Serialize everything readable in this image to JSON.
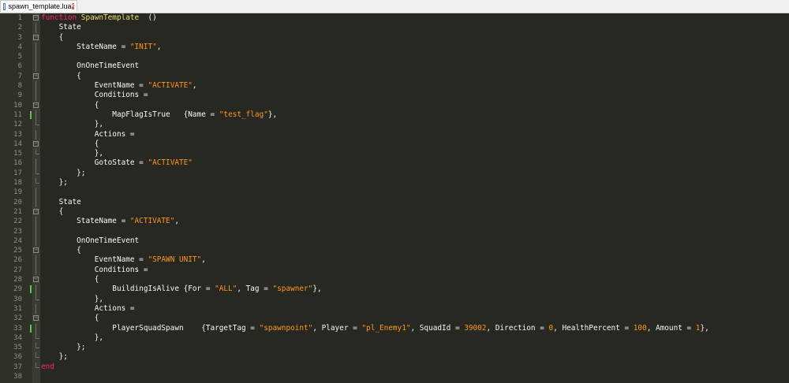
{
  "tab": {
    "label": "spawn_template.lua",
    "file_icon": "lua-file-icon",
    "close_glyph": "x"
  },
  "lines": [
    {
      "n": "1",
      "fold": "open",
      "segs": [
        [
          "kw",
          "function"
        ],
        [
          "fn",
          " SpawnTemplate"
        ],
        [
          "",
          "  ()"
        ]
      ]
    },
    {
      "n": "2",
      "fold": "line",
      "segs": [
        [
          "",
          "    State"
        ]
      ]
    },
    {
      "n": "3",
      "fold": "open",
      "segs": [
        [
          "",
          "    {"
        ]
      ]
    },
    {
      "n": "4",
      "fold": "line",
      "segs": [
        [
          "",
          "        StateName = "
        ],
        [
          "str",
          "\"INIT\""
        ],
        [
          "",
          ","
        ]
      ]
    },
    {
      "n": "5",
      "fold": "line",
      "segs": [
        [
          "",
          ""
        ]
      ]
    },
    {
      "n": "6",
      "fold": "line",
      "segs": [
        [
          "",
          "        OnOneTimeEvent"
        ]
      ]
    },
    {
      "n": "7",
      "fold": "open",
      "segs": [
        [
          "",
          "        {"
        ]
      ]
    },
    {
      "n": "8",
      "fold": "line",
      "segs": [
        [
          "",
          "            EventName = "
        ],
        [
          "str",
          "\"ACTIVATE\""
        ],
        [
          "",
          ","
        ]
      ]
    },
    {
      "n": "9",
      "fold": "line",
      "segs": [
        [
          "",
          "            Conditions ="
        ]
      ]
    },
    {
      "n": "10",
      "fold": "open",
      "segs": [
        [
          "",
          "            {"
        ]
      ]
    },
    {
      "n": "11",
      "fold": "line",
      "chg": true,
      "segs": [
        [
          "",
          "                MapFlagIsTrue   {Name = "
        ],
        [
          "str",
          "\"test_flag\""
        ],
        [
          "",
          "},"
        ]
      ]
    },
    {
      "n": "12",
      "fold": "end",
      "segs": [
        [
          "",
          "            },"
        ]
      ]
    },
    {
      "n": "13",
      "fold": "line",
      "segs": [
        [
          "",
          "            Actions ="
        ]
      ]
    },
    {
      "n": "14",
      "fold": "open",
      "segs": [
        [
          "",
          "            {"
        ]
      ]
    },
    {
      "n": "15",
      "fold": "end",
      "segs": [
        [
          "",
          "            },"
        ]
      ]
    },
    {
      "n": "16",
      "fold": "line",
      "segs": [
        [
          "",
          "            GotoState = "
        ],
        [
          "str",
          "\"ACTIVATE\""
        ]
      ]
    },
    {
      "n": "17",
      "fold": "end",
      "segs": [
        [
          "",
          "        };"
        ]
      ]
    },
    {
      "n": "18",
      "fold": "end",
      "segs": [
        [
          "",
          "    };"
        ]
      ]
    },
    {
      "n": "19",
      "fold": "line",
      "segs": [
        [
          "",
          ""
        ]
      ]
    },
    {
      "n": "20",
      "fold": "line",
      "segs": [
        [
          "",
          "    State"
        ]
      ]
    },
    {
      "n": "21",
      "fold": "open",
      "segs": [
        [
          "",
          "    {"
        ]
      ]
    },
    {
      "n": "22",
      "fold": "line",
      "segs": [
        [
          "",
          "        StateName = "
        ],
        [
          "str",
          "\"ACTIVATE\""
        ],
        [
          "",
          ","
        ]
      ]
    },
    {
      "n": "23",
      "fold": "line",
      "segs": [
        [
          "",
          ""
        ]
      ]
    },
    {
      "n": "24",
      "fold": "line",
      "segs": [
        [
          "",
          "        OnOneTimeEvent"
        ]
      ]
    },
    {
      "n": "25",
      "fold": "open",
      "segs": [
        [
          "",
          "        {"
        ]
      ]
    },
    {
      "n": "26",
      "fold": "line",
      "segs": [
        [
          "",
          "            EventName = "
        ],
        [
          "str",
          "\"SPAWN UNIT\""
        ],
        [
          "",
          ","
        ]
      ]
    },
    {
      "n": "27",
      "fold": "line",
      "segs": [
        [
          "",
          "            Conditions ="
        ]
      ]
    },
    {
      "n": "28",
      "fold": "open",
      "segs": [
        [
          "",
          "            {"
        ]
      ]
    },
    {
      "n": "29",
      "fold": "line",
      "chg": true,
      "segs": [
        [
          "",
          "                BuildingIsAlive {For = "
        ],
        [
          "str",
          "\"ALL\""
        ],
        [
          "",
          ", Tag = "
        ],
        [
          "str",
          "\"spawner\""
        ],
        [
          "",
          "},"
        ]
      ]
    },
    {
      "n": "30",
      "fold": "end",
      "segs": [
        [
          "",
          "            },"
        ]
      ]
    },
    {
      "n": "31",
      "fold": "line",
      "segs": [
        [
          "",
          "            Actions ="
        ]
      ]
    },
    {
      "n": "32",
      "fold": "open",
      "segs": [
        [
          "",
          "            {"
        ]
      ]
    },
    {
      "n": "33",
      "fold": "line",
      "chg": true,
      "segs": [
        [
          "",
          "                PlayerSquadSpawn    {TargetTag = "
        ],
        [
          "str",
          "\"spawnpoint\""
        ],
        [
          "",
          ", Player = "
        ],
        [
          "str",
          "\"pl_Enemy1\""
        ],
        [
          "",
          ", SquadId = "
        ],
        [
          "num",
          "39002"
        ],
        [
          "",
          ", Direction = "
        ],
        [
          "num",
          "0"
        ],
        [
          "",
          ", HealthPercent = "
        ],
        [
          "num",
          "100"
        ],
        [
          "",
          ", Amount = "
        ],
        [
          "num",
          "1"
        ],
        [
          "",
          "},"
        ]
      ]
    },
    {
      "n": "34",
      "fold": "end",
      "segs": [
        [
          "",
          "            },"
        ]
      ]
    },
    {
      "n": "35",
      "fold": "end",
      "segs": [
        [
          "",
          "        };"
        ]
      ]
    },
    {
      "n": "36",
      "fold": "end",
      "segs": [
        [
          "",
          "    };"
        ]
      ]
    },
    {
      "n": "37",
      "fold": "end",
      "segs": [
        [
          "kw",
          "end"
        ]
      ]
    },
    {
      "n": "38",
      "fold": "none",
      "segs": [
        [
          "",
          ""
        ]
      ]
    }
  ],
  "colors": {
    "editor_bg": "#272822",
    "keyword": "#f92672",
    "function_name": "#e6db74",
    "string": "#fd971f",
    "number": "#fd971f",
    "changed_marker": "#6ec25d"
  }
}
